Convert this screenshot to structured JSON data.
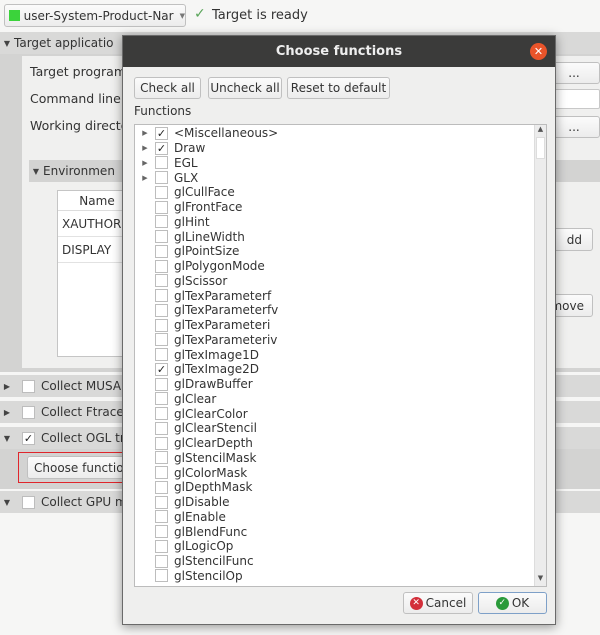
{
  "toolbar": {
    "target_combo": "user-System-Product-Nar",
    "status": "Target is ready",
    "status_icon": "check-icon"
  },
  "background": {
    "target_application": "Target applicatio",
    "target_program": "Target program",
    "command_line": "Command line a",
    "working_directory": "Working directo",
    "browse": "...",
    "environment": "Environmen",
    "table_header_name": "Name",
    "env_rows": [
      "XAUTHOR",
      "DISPLAY"
    ],
    "add": "dd",
    "remove": "move",
    "collect_musa": "Collect MUSA",
    "collect_ftrace": "Collect Ftrace",
    "collect_ogl": "Collect OGL tr",
    "choose_functions": "Choose functio",
    "collect_gpu": "Collect GPU m",
    "collect_ogl_checked": true,
    "highlight_color": "#e0262c"
  },
  "dialog": {
    "title": "Choose functions",
    "check_all": "Check all",
    "uncheck_all": "Uncheck all",
    "reset": "Reset to default",
    "functions_label": "Functions",
    "cancel": "Cancel",
    "ok": "OK",
    "items": [
      {
        "label": "<Miscellaneous>",
        "checked": true,
        "expandable": true
      },
      {
        "label": "Draw",
        "checked": true,
        "expandable": true
      },
      {
        "label": "EGL",
        "checked": false,
        "expandable": true
      },
      {
        "label": "GLX",
        "checked": false,
        "expandable": true
      },
      {
        "label": "glCullFace",
        "checked": false
      },
      {
        "label": "glFrontFace",
        "checked": false
      },
      {
        "label": "glHint",
        "checked": false
      },
      {
        "label": "glLineWidth",
        "checked": false
      },
      {
        "label": "glPointSize",
        "checked": false
      },
      {
        "label": "glPolygonMode",
        "checked": false
      },
      {
        "label": "glScissor",
        "checked": false
      },
      {
        "label": "glTexParameterf",
        "checked": false
      },
      {
        "label": "glTexParameterfv",
        "checked": false
      },
      {
        "label": "glTexParameteri",
        "checked": false
      },
      {
        "label": "glTexParameteriv",
        "checked": false
      },
      {
        "label": "glTexImage1D",
        "checked": false
      },
      {
        "label": "glTexImage2D",
        "checked": true
      },
      {
        "label": "glDrawBuffer",
        "checked": false
      },
      {
        "label": "glClear",
        "checked": false
      },
      {
        "label": "glClearColor",
        "checked": false
      },
      {
        "label": "glClearStencil",
        "checked": false
      },
      {
        "label": "glClearDepth",
        "checked": false
      },
      {
        "label": "glStencilMask",
        "checked": false
      },
      {
        "label": "glColorMask",
        "checked": false
      },
      {
        "label": "glDepthMask",
        "checked": false
      },
      {
        "label": "glDisable",
        "checked": false
      },
      {
        "label": "glEnable",
        "checked": false
      },
      {
        "label": "glBlendFunc",
        "checked": false
      },
      {
        "label": "glLogicOp",
        "checked": false
      },
      {
        "label": "glStencilFunc",
        "checked": false
      },
      {
        "label": "glStencilOp",
        "checked": false
      }
    ]
  }
}
